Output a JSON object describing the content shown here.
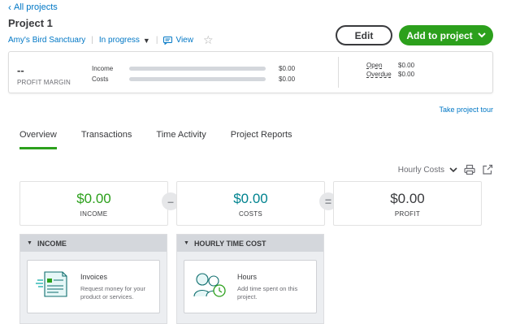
{
  "nav": {
    "back_label": "All projects"
  },
  "project": {
    "title": "Project 1",
    "customer": "Amy's Bird Sanctuary",
    "status": "In progress",
    "view_label": "View"
  },
  "actions": {
    "edit_label": "Edit",
    "add_label": "Add to project"
  },
  "summary": {
    "profit_margin_value": "--",
    "profit_margin_label": "PROFIT MARGIN",
    "income_label": "Income",
    "income_value": "$0.00",
    "costs_label": "Costs",
    "costs_value": "$0.00",
    "open_label": "Open",
    "open_value": "$0.00",
    "overdue_label": "Overdue",
    "overdue_value": "$0.00",
    "income_progress": 0,
    "costs_progress": 0
  },
  "tour_label": "Take project tour",
  "tabs": [
    {
      "label": "Overview",
      "active": true
    },
    {
      "label": "Transactions",
      "active": false
    },
    {
      "label": "Time Activity",
      "active": false
    },
    {
      "label": "Project Reports",
      "active": false
    }
  ],
  "toolbar": {
    "selected_view": "Hourly Costs"
  },
  "stats": {
    "income": {
      "value": "$0.00",
      "label": "INCOME",
      "color": "#2ca01c"
    },
    "costs": {
      "value": "$0.00",
      "label": "COSTS",
      "color": "#00838f"
    },
    "profit": {
      "value": "$0.00",
      "label": "PROFIT",
      "color": "#393a3d"
    },
    "minus_symbol": "–",
    "equals_symbol": "="
  },
  "panels": {
    "income": {
      "title": "INCOME",
      "card_title": "Invoices",
      "card_desc": "Request money for your product or services."
    },
    "time_cost": {
      "title": "HOURLY TIME COST",
      "card_title": "Hours",
      "card_desc": "Add time spent on this project."
    }
  },
  "colors": {
    "accent": "#2ca01c",
    "link": "#0077c5",
    "teal": "#00838f"
  },
  "icons": [
    "chevron-left-icon",
    "chevron-down-icon",
    "comment-icon",
    "star-icon",
    "print-icon",
    "export-icon",
    "invoice-illustration",
    "people-clock-illustration"
  ]
}
